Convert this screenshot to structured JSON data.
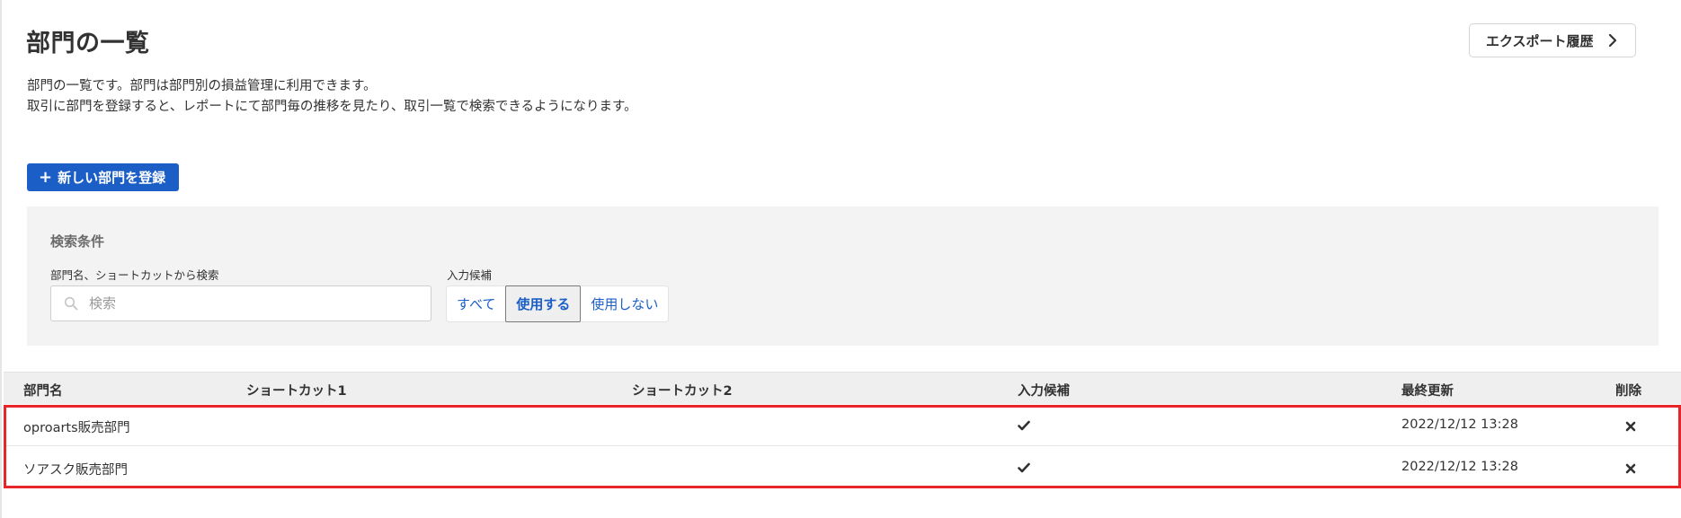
{
  "header": {
    "title": "部門の一覧",
    "export_button": "エクスポート履歴"
  },
  "description": {
    "line1": "部門の一覧です。部門は部門別の損益管理に利用できます。",
    "line2": "取引に部門を登録すると、レポートにて部門毎の推移を見たり、取引一覧で検索できるようになります。"
  },
  "actions": {
    "add_button": "新しい部門を登録"
  },
  "search": {
    "title": "検索条件",
    "keyword_label": "部門名、ショートカットから検索",
    "placeholder": "検索",
    "value": "",
    "candidate_label": "入力候補",
    "options": [
      "すべて",
      "使用する",
      "使用しない"
    ],
    "selected": "使用する"
  },
  "table": {
    "columns": [
      "部門名",
      "ショートカット1",
      "ショートカット2",
      "入力候補",
      "最終更新",
      "削除"
    ],
    "rows": [
      {
        "name": "oproarts販売部門",
        "shortcut1": "",
        "shortcut2": "",
        "candidate": true,
        "updated": "2022/12/12 13:28"
      },
      {
        "name": "ソアスク販売部門",
        "shortcut1": "",
        "shortcut2": "",
        "candidate": true,
        "updated": "2022/12/12 13:28"
      }
    ]
  },
  "icons": {
    "export_chevron": "chevron-right-icon",
    "add": "plus-icon",
    "search": "search-icon",
    "candidate": "check-icon",
    "delete": "close-icon"
  },
  "colors": {
    "primary": "#1a5ec6",
    "highlight": "#e8262a",
    "panel_bg": "#f4f3f3"
  }
}
